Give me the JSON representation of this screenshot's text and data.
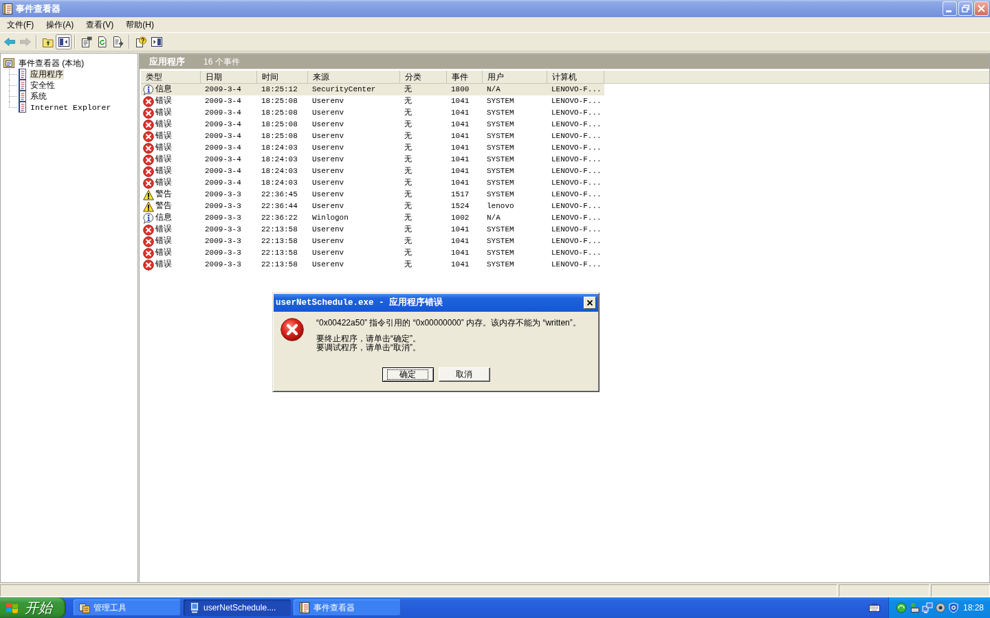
{
  "window": {
    "title": "事件查看器"
  },
  "menu": [
    {
      "label": "文件(F)"
    },
    {
      "label": "操作(A)"
    },
    {
      "label": "查看(V)"
    },
    {
      "label": "帮助(H)"
    }
  ],
  "toolbar": [
    {
      "buttons": [
        {
          "kind": "back",
          "disabled": false,
          "pressed": false
        },
        {
          "kind": "forward",
          "disabled": true,
          "pressed": false
        }
      ]
    },
    {
      "buttons": [
        {
          "kind": "up",
          "disabled": false,
          "pressed": false
        },
        {
          "kind": "tree",
          "disabled": false,
          "pressed": true
        }
      ]
    },
    {
      "buttons": [
        {
          "kind": "properties",
          "disabled": false,
          "pressed": false
        },
        {
          "kind": "refresh",
          "disabled": false,
          "pressed": false
        },
        {
          "kind": "export",
          "disabled": false,
          "pressed": false
        }
      ]
    },
    {
      "buttons": [
        {
          "kind": "help",
          "disabled": false,
          "pressed": false
        },
        {
          "kind": "action",
          "disabled": false,
          "pressed": false
        }
      ]
    }
  ],
  "tree": {
    "label": "事件查看器 (本地)",
    "selected": false,
    "children": [
      {
        "label": "应用程序",
        "selected": true
      },
      {
        "label": "安全性",
        "selected": false
      },
      {
        "label": "系统",
        "selected": false
      },
      {
        "label": "Internet Explorer",
        "selected": false
      }
    ]
  },
  "pane": {
    "title": "应用程序",
    "count": "16 个事件"
  },
  "table": {
    "columns": [
      "类型",
      "日期",
      "时间",
      "来源",
      "分类",
      "事件",
      "用户",
      "计算机"
    ],
    "rows": [
      {
        "kind": "info",
        "selected": true,
        "cells": [
          "信息",
          "2009-3-4",
          "18:25:12",
          "SecurityCenter",
          "无",
          "1800",
          "N/A",
          "LENOVO-F..."
        ]
      },
      {
        "kind": "error",
        "selected": false,
        "cells": [
          "错误",
          "2009-3-4",
          "18:25:08",
          "Userenv",
          "无",
          "1041",
          "SYSTEM",
          "LENOVO-F..."
        ]
      },
      {
        "kind": "error",
        "selected": false,
        "cells": [
          "错误",
          "2009-3-4",
          "18:25:08",
          "Userenv",
          "无",
          "1041",
          "SYSTEM",
          "LENOVO-F..."
        ]
      },
      {
        "kind": "error",
        "selected": false,
        "cells": [
          "错误",
          "2009-3-4",
          "18:25:08",
          "Userenv",
          "无",
          "1041",
          "SYSTEM",
          "LENOVO-F..."
        ]
      },
      {
        "kind": "error",
        "selected": false,
        "cells": [
          "错误",
          "2009-3-4",
          "18:25:08",
          "Userenv",
          "无",
          "1041",
          "SYSTEM",
          "LENOVO-F..."
        ]
      },
      {
        "kind": "error",
        "selected": false,
        "cells": [
          "错误",
          "2009-3-4",
          "18:24:03",
          "Userenv",
          "无",
          "1041",
          "SYSTEM",
          "LENOVO-F..."
        ]
      },
      {
        "kind": "error",
        "selected": false,
        "cells": [
          "错误",
          "2009-3-4",
          "18:24:03",
          "Userenv",
          "无",
          "1041",
          "SYSTEM",
          "LENOVO-F..."
        ]
      },
      {
        "kind": "error",
        "selected": false,
        "cells": [
          "错误",
          "2009-3-4",
          "18:24:03",
          "Userenv",
          "无",
          "1041",
          "SYSTEM",
          "LENOVO-F..."
        ]
      },
      {
        "kind": "error",
        "selected": false,
        "cells": [
          "错误",
          "2009-3-4",
          "18:24:03",
          "Userenv",
          "无",
          "1041",
          "SYSTEM",
          "LENOVO-F..."
        ]
      },
      {
        "kind": "warning",
        "selected": false,
        "cells": [
          "警告",
          "2009-3-3",
          "22:36:45",
          "Userenv",
          "无",
          "1517",
          "SYSTEM",
          "LENOVO-F..."
        ]
      },
      {
        "kind": "warning",
        "selected": false,
        "cells": [
          "警告",
          "2009-3-3",
          "22:36:44",
          "Userenv",
          "无",
          "1524",
          "lenovo",
          "LENOVO-F..."
        ]
      },
      {
        "kind": "info",
        "selected": false,
        "cells": [
          "信息",
          "2009-3-3",
          "22:36:22",
          "Winlogon",
          "无",
          "1002",
          "N/A",
          "LENOVO-F..."
        ]
      },
      {
        "kind": "error",
        "selected": false,
        "cells": [
          "错误",
          "2009-3-3",
          "22:13:58",
          "Userenv",
          "无",
          "1041",
          "SYSTEM",
          "LENOVO-F..."
        ]
      },
      {
        "kind": "error",
        "selected": false,
        "cells": [
          "错误",
          "2009-3-3",
          "22:13:58",
          "Userenv",
          "无",
          "1041",
          "SYSTEM",
          "LENOVO-F..."
        ]
      },
      {
        "kind": "error",
        "selected": false,
        "cells": [
          "错误",
          "2009-3-3",
          "22:13:58",
          "Userenv",
          "无",
          "1041",
          "SYSTEM",
          "LENOVO-F..."
        ]
      },
      {
        "kind": "error",
        "selected": false,
        "cells": [
          "错误",
          "2009-3-3",
          "22:13:58",
          "Userenv",
          "无",
          "1041",
          "SYSTEM",
          "LENOVO-F..."
        ]
      }
    ]
  },
  "dialog": {
    "title": "userNetSchedule.exe - 应用程序错误",
    "message": "“0x00422a50” 指令引用的 “0x00000000” 内存。该内存不能为 “written”。",
    "hints": [
      "要终止程序，请单击“确定”。",
      "要调试程序，请单击“取消”。"
    ],
    "buttons": [
      {
        "label": "确定",
        "focused": true
      },
      {
        "label": "取消",
        "focused": false
      }
    ]
  },
  "taskbar": {
    "start_label": "开始",
    "tasks": [
      {
        "kind": "tools",
        "label": "管理工具",
        "selected": false
      },
      {
        "kind": "app",
        "label": "userNetSchedule....",
        "selected": true
      },
      {
        "kind": "viewer",
        "label": "事件查看器",
        "selected": false
      }
    ],
    "clock": "18:28"
  }
}
